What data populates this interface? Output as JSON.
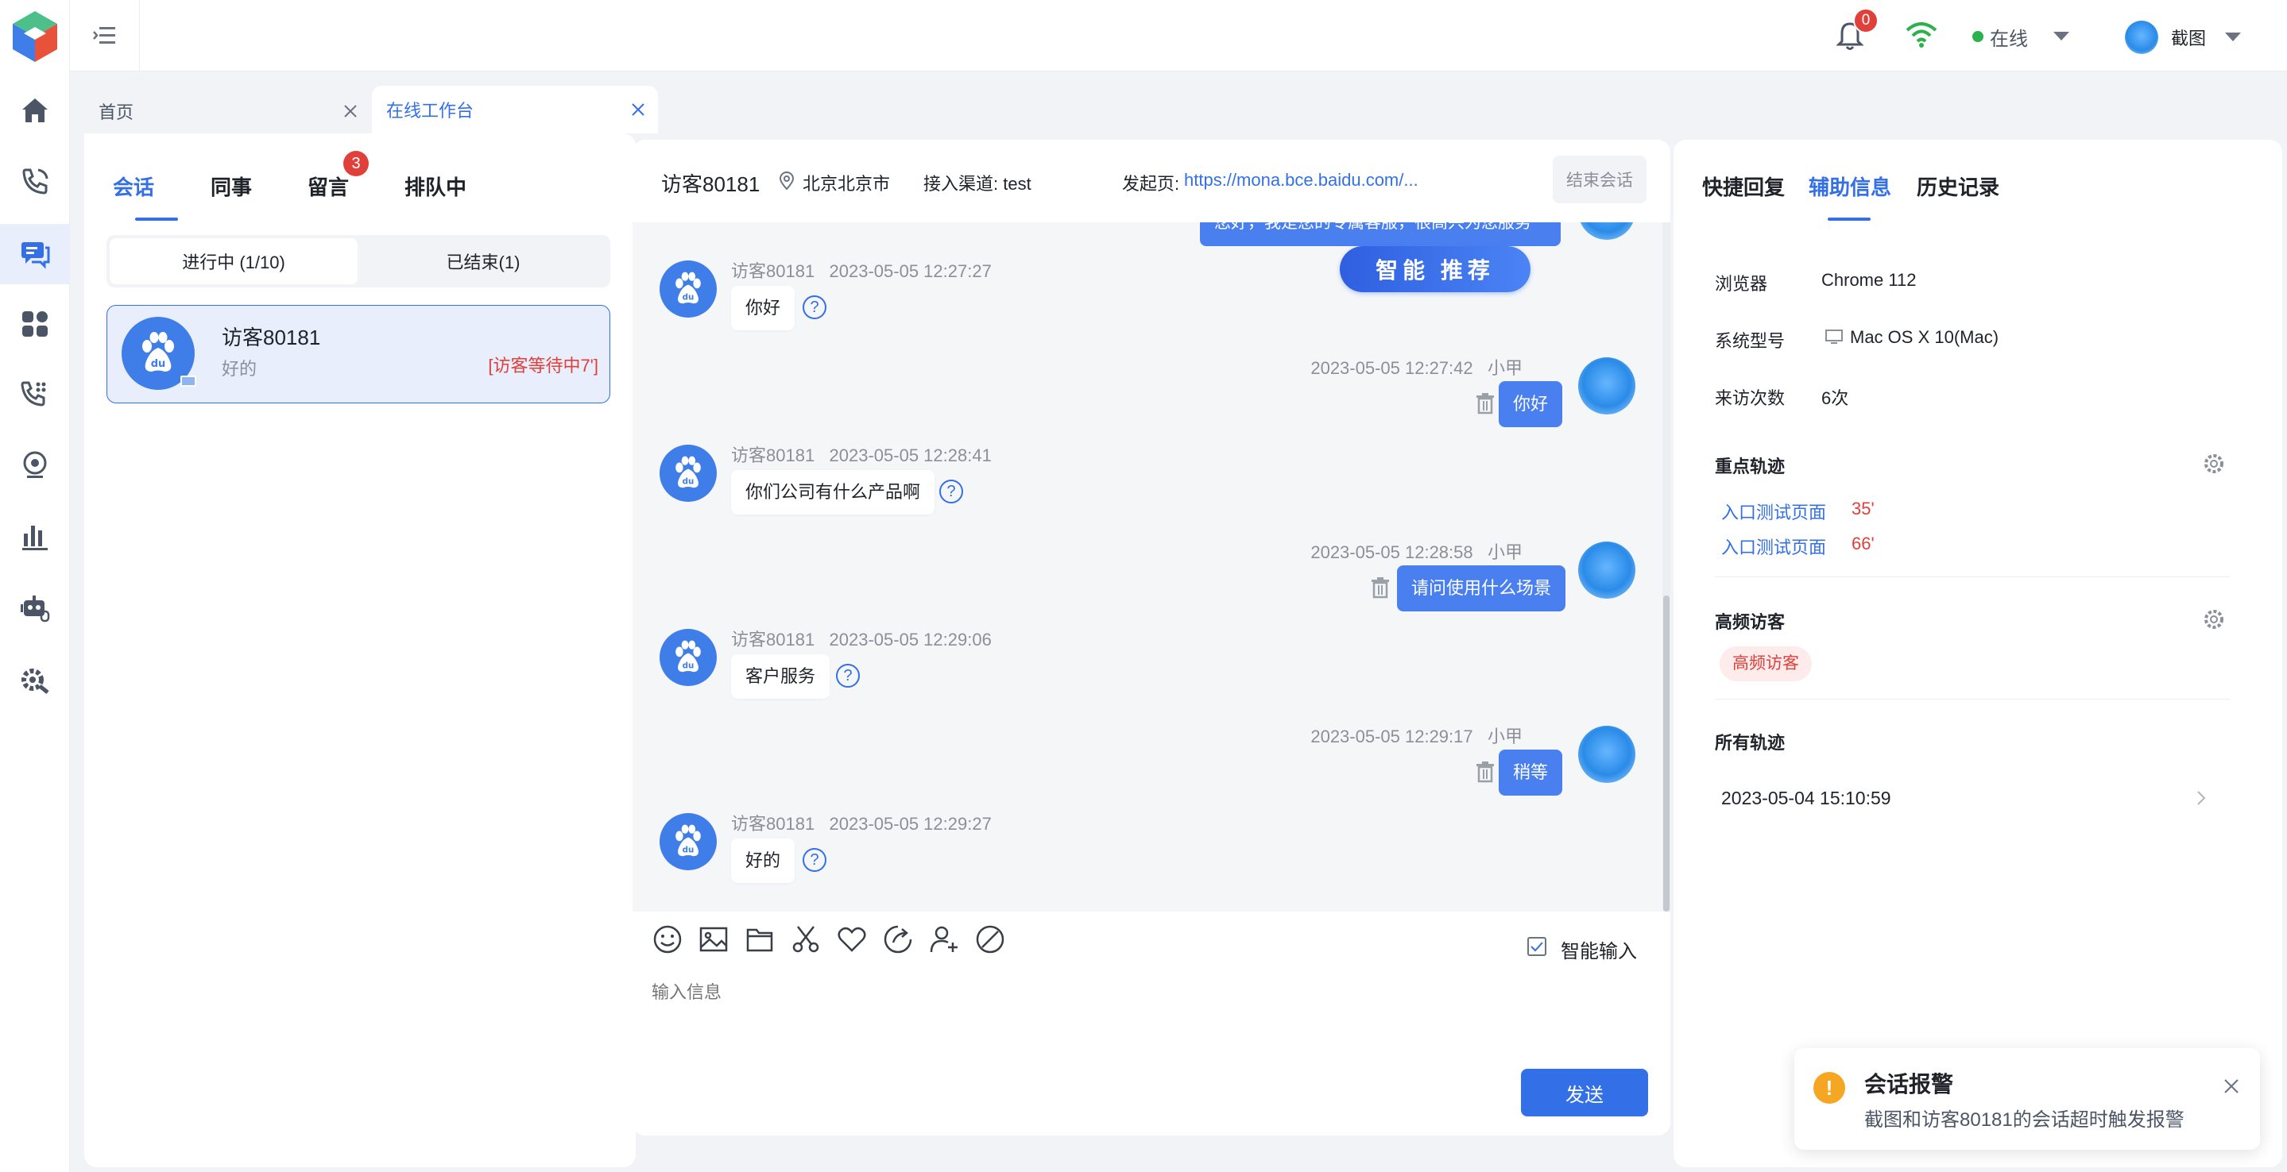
{
  "topbar": {
    "notification_count": "0",
    "status": "在线",
    "username": "截图"
  },
  "tabs": [
    {
      "label": "首页"
    },
    {
      "label": "在线工作台"
    }
  ],
  "left": {
    "tabs": [
      "会话",
      "同事",
      "留言",
      "排队中"
    ],
    "message_badge": "3",
    "segments": [
      "进行中 (1/10)",
      "已结束(1)"
    ],
    "session": {
      "name": "访客80181",
      "last": "好的",
      "status": "[访客等待中7']"
    }
  },
  "chat": {
    "visitor": "访客80181",
    "location": "北京北京市",
    "channel": "接入渠道: test",
    "source_label": "发起页:",
    "source_url": "https://mona.bce.baidu.com/...",
    "end_button": "结束会话",
    "top_partial": "您好，我是您的专属客服，很高兴为您服务",
    "smart_badge": "智能  推荐",
    "messages": [
      {
        "who": "访客80181",
        "time": "2023-05-05 12:27:27",
        "text": "你好"
      },
      {
        "who": "小甲",
        "time": "2023-05-05 12:27:42",
        "text": "你好"
      },
      {
        "who": "访客80181",
        "time": "2023-05-05 12:28:41",
        "text": "你们公司有什么产品啊"
      },
      {
        "who": "小甲",
        "time": "2023-05-05 12:28:58",
        "text": "请问使用什么场景"
      },
      {
        "who": "访客80181",
        "time": "2023-05-05 12:29:06",
        "text": "客户服务"
      },
      {
        "who": "小甲",
        "time": "2023-05-05 12:29:17",
        "text": "稍等"
      },
      {
        "who": "访客80181",
        "time": "2023-05-05 12:29:27",
        "text": "好的"
      }
    ],
    "smart_input": "智能输入",
    "input_placeholder": "输入信息",
    "send": "发送"
  },
  "right": {
    "tabs": [
      "快捷回复",
      "辅助信息",
      "历史记录"
    ],
    "info": [
      {
        "label": "浏览器",
        "value": "Chrome 112"
      },
      {
        "label": "系统型号",
        "value": "Mac OS X 10(Mac)"
      },
      {
        "label": "来访次数",
        "value": "6次"
      }
    ],
    "key_track_title": "重点轨迹",
    "key_tracks": [
      {
        "page": "入口测试页面",
        "time": "35'"
      },
      {
        "page": "入口测试页面",
        "time": "66'"
      }
    ],
    "frequent_title": "高频访客",
    "frequent_tag": "高频访客",
    "all_tracks_title": "所有轨迹",
    "all_tracks_date": "2023-05-04 15:10:59"
  },
  "toast": {
    "title": "会话报警",
    "body": "截图和访客80181的会话超时触发报警"
  },
  "colors": {
    "accent": "#3370e8",
    "danger": "#e0403a",
    "warning": "#f5a623",
    "online": "#2bb24c"
  }
}
